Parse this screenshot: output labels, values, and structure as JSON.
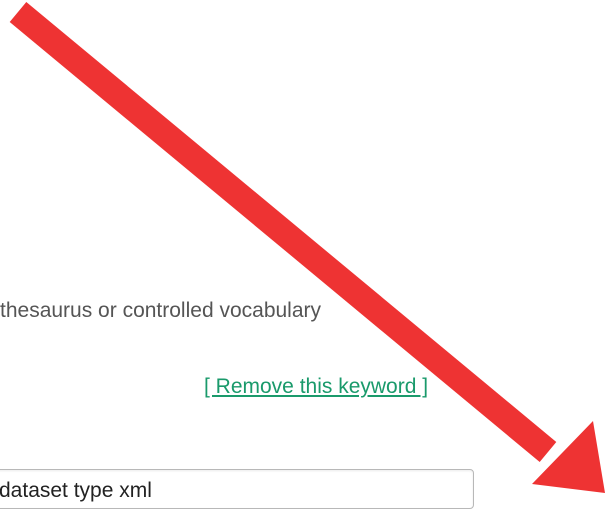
{
  "keyword_panel": {
    "help_text": "thesaurus or controlled vocabulary",
    "remove_link_label": "[ Remove this keyword ]",
    "keyword_value": "dataset type xml"
  },
  "colors": {
    "link": "#1a9a6b",
    "annotation_arrow": "#ee3333"
  }
}
